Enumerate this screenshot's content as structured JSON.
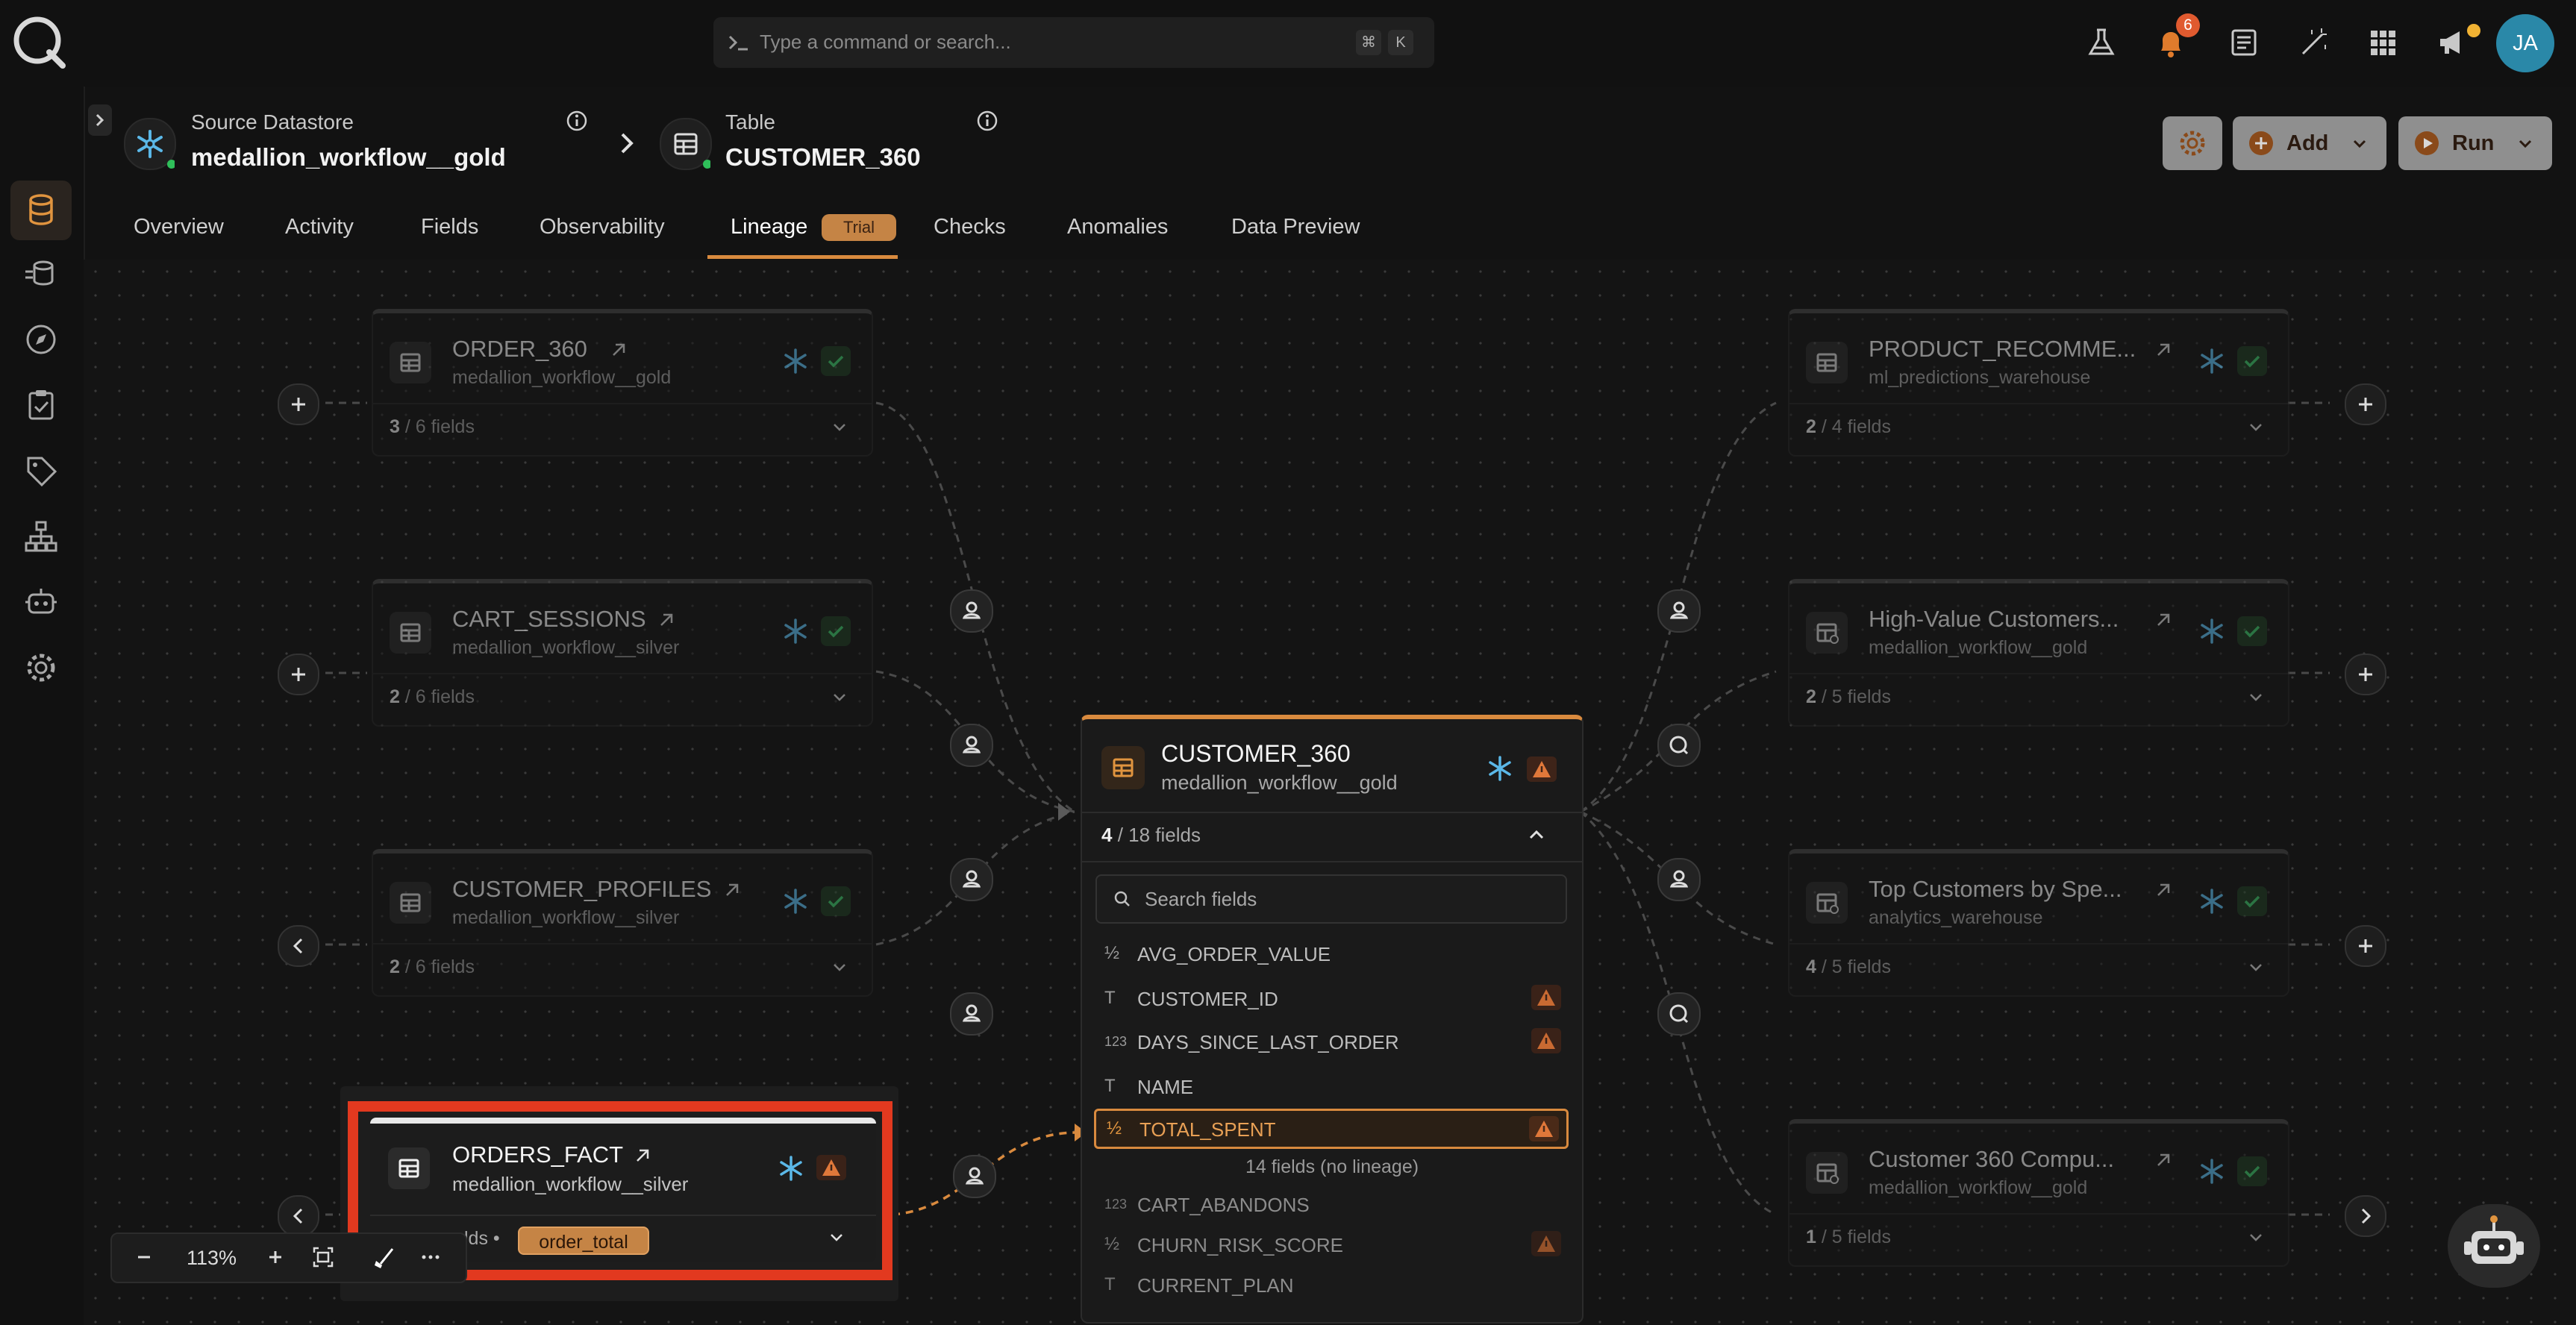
{
  "command_bar": {
    "placeholder": "Type a command or search...",
    "shortcut_mod": "⌘",
    "shortcut_key": "K"
  },
  "notifications": {
    "count": "6"
  },
  "user": {
    "initials": "JA"
  },
  "breadcrumb": {
    "datastore_label": "Source Datastore",
    "datastore_name": "medallion_workflow__gold",
    "table_label": "Table",
    "table_name": "CUSTOMER_360"
  },
  "header_actions": {
    "add_label": "Add",
    "run_label": "Run"
  },
  "tabs": [
    {
      "label": "Overview"
    },
    {
      "label": "Activity"
    },
    {
      "label": "Fields"
    },
    {
      "label": "Observability"
    },
    {
      "label": "Lineage",
      "badge": "Trial",
      "active": true
    },
    {
      "label": "Checks"
    },
    {
      "label": "Anomalies"
    },
    {
      "label": "Data Preview"
    }
  ],
  "upstream": [
    {
      "title": "ORDER_360",
      "subtitle": "medallion_workflow__gold",
      "fields_shown": "3",
      "fields_total": "/ 6 fields"
    },
    {
      "title": "CART_SESSIONS",
      "subtitle": "medallion_workflow__silver",
      "fields_shown": "2",
      "fields_total": "/ 6 fields"
    },
    {
      "title": "CUSTOMER_PROFILES",
      "subtitle": "medallion_workflow__silver",
      "fields_shown": "2",
      "fields_total": "/ 6 fields"
    }
  ],
  "orders_fact": {
    "title": "ORDERS_FACT",
    "subtitle": "medallion_workflow__silver",
    "fields_partial": "lds",
    "field_chip": "order_total"
  },
  "downstream": [
    {
      "title": "PRODUCT_RECOMME...",
      "subtitle": "ml_predictions_warehouse",
      "fields_shown": "2",
      "fields_total": "/ 4 fields"
    },
    {
      "title": "High-Value Customers...",
      "subtitle": "medallion_workflow__gold",
      "fields_shown": "2",
      "fields_total": "/ 5 fields"
    },
    {
      "title": "Top Customers by Spe...",
      "subtitle": "analytics_warehouse",
      "fields_shown": "4",
      "fields_total": "/ 5 fields"
    },
    {
      "title": "Customer 360 Compu...",
      "subtitle": "medallion_workflow__gold",
      "fields_shown": "1",
      "fields_total": "/ 5 fields"
    }
  ],
  "center_node": {
    "title": "CUSTOMER_360",
    "subtitle": "medallion_workflow__gold",
    "fields_shown": "4",
    "fields_total": "/ 18 fields",
    "search_placeholder": "Search fields",
    "lineage_fields": [
      {
        "type": "½",
        "name": "AVG_ORDER_VALUE",
        "warn": false
      },
      {
        "type": "T",
        "name": "CUSTOMER_ID",
        "warn": true
      },
      {
        "type": "123",
        "name": "DAYS_SINCE_LAST_ORDER",
        "warn": true
      },
      {
        "type": "T",
        "name": "NAME",
        "warn": false
      },
      {
        "type": "½",
        "name": "TOTAL_SPENT",
        "warn": true,
        "selected": true
      }
    ],
    "no_lineage_label": "14 fields (no lineage)",
    "other_fields": [
      {
        "type": "123",
        "name": "CART_ABANDONS",
        "warn": false
      },
      {
        "type": "½",
        "name": "CHURN_RISK_SCORE",
        "warn": true
      },
      {
        "type": "T",
        "name": "CURRENT_PLAN",
        "warn": false
      }
    ]
  },
  "zoom": {
    "level": "113%"
  },
  "colors": {
    "accent": "#d98a3e",
    "highlight": "#e2391f",
    "background": "#121212",
    "snowflake": "#5bb8e8"
  }
}
